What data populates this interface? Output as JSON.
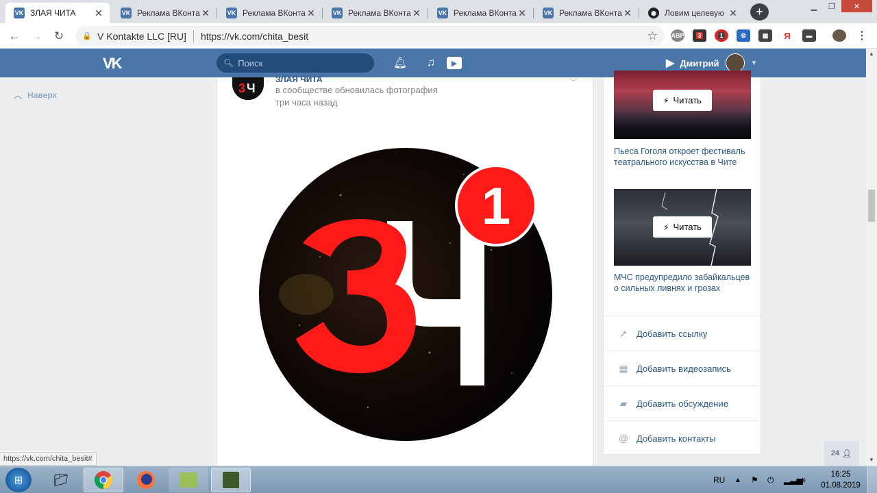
{
  "browser": {
    "tabs": [
      {
        "label": "ЗЛАЯ ЧИТА",
        "icon": "vk-favicon",
        "active": true
      },
      {
        "label": "Реклама ВКонта",
        "icon": "vk-favicon",
        "active": false
      },
      {
        "label": "Реклама ВКонта",
        "icon": "vk-favicon",
        "active": false
      },
      {
        "label": "Реклама ВКонта",
        "icon": "vk-favicon",
        "active": false
      },
      {
        "label": "Реклама ВКонта",
        "icon": "vk-favicon",
        "active": false
      },
      {
        "label": "Реклама ВКонта",
        "icon": "vk-favicon",
        "active": false
      },
      {
        "label": "Ловим целевую",
        "icon": "round-dark-favicon",
        "active": false
      }
    ],
    "site_owner": "V Kontakte LLC [RU]",
    "url": "https://vk.com/chita_besit",
    "extension_badges": [
      "3",
      "1"
    ]
  },
  "vk": {
    "search_placeholder": "Поиск",
    "user_name": "Дмитрий",
    "back_to_top": "Наверх"
  },
  "post": {
    "author": "ЗЛАЯ ЧИТА",
    "action": "в сообществе обновилась фотография",
    "time": "три часа назад",
    "photo_badge": "1"
  },
  "sidebar": {
    "read_label": "Читать",
    "news": [
      {
        "title": "Пьеса Гоголя откроет фестиваль театрального искусства в Чите"
      },
      {
        "title": "МЧС предупредило забайкальцев о сильных ливнях и грозах"
      }
    ],
    "actions": [
      {
        "label": "Добавить ссылку",
        "icon": "pin-icon"
      },
      {
        "label": "Добавить видеозапись",
        "icon": "film-icon"
      },
      {
        "label": "Добавить обсуждение",
        "icon": "chat-icon"
      },
      {
        "label": "Добавить контакты",
        "icon": "at-icon"
      }
    ]
  },
  "status_bar_url": "https://vk.com/chita_besit#",
  "friends_online": "24",
  "taskbar": {
    "language": "RU",
    "time": "16:25",
    "date": "01.08.2019"
  },
  "colors": {
    "vk_blue": "#4a76a8",
    "link_blue": "#2a5885",
    "logo_red": "#ff1a1a"
  }
}
